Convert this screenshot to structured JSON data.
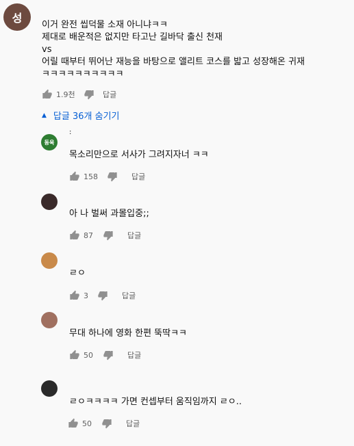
{
  "main": {
    "avatar_letter": "성",
    "text": "이거 완전 씹덕물 소재 아니냐ㅋㅋ\n제대로 배운적은 없지만 타고난 길바닥 출신 천재\n vs\n어릴 때부터 뛰어난 재능을 바탕으로 앨리트 코스를 밟고 성장해온 귀재\nㅋㅋㅋㅋㅋㅋㅋㅋㅋㅋ",
    "likes": "1.9천",
    "reply_label": "답글"
  },
  "toggle": {
    "label": "답글 36개 숨기기"
  },
  "replies": [
    {
      "avatar_text": "동욱",
      "avatar_color": "#2e7d32",
      "author": ":",
      "text": "목소리만으로 서사가 그려지자너 ㅋㅋ",
      "likes": "158",
      "reply_label": "답글"
    },
    {
      "avatar_text": "",
      "avatar_color": "#3a2a2a",
      "author": "",
      "text": "아 나 벌써 과몰입중;;",
      "likes": "87",
      "reply_label": "답글"
    },
    {
      "avatar_text": "",
      "avatar_color": "#c98a4a",
      "author": "",
      "text": "ㄹㅇ",
      "likes": "3",
      "reply_label": "답글"
    },
    {
      "avatar_text": "",
      "avatar_color": "#a07060",
      "author": "",
      "text": "무대 하나에 영화 한편 뚝딱ㅋㅋ",
      "likes": "50",
      "reply_label": "답글"
    },
    {
      "avatar_text": "",
      "avatar_color": "#2a2a2a",
      "author": "",
      "text": "ㄹㅇㅋㅋㅋㅋ 가면 컨셉부터 움직임까지 ㄹㅇ..",
      "likes": "50",
      "reply_label": "답글"
    }
  ]
}
